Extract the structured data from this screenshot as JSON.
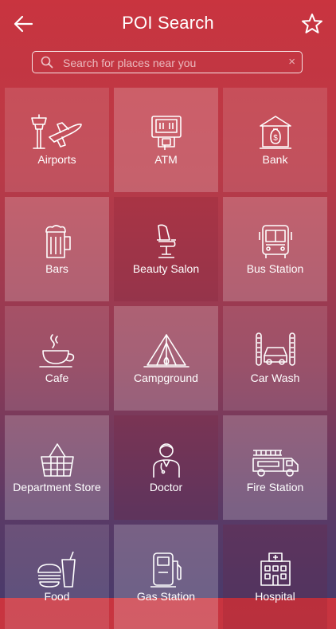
{
  "header": {
    "title": "POI Search"
  },
  "search": {
    "placeholder": "Search for places near you",
    "clear": "×"
  },
  "categories": [
    {
      "label": "Airports",
      "icon": "airport-icon"
    },
    {
      "label": "ATM",
      "icon": "atm-icon"
    },
    {
      "label": "Bank",
      "icon": "bank-icon"
    },
    {
      "label": "Bars",
      "icon": "beer-mug-icon"
    },
    {
      "label": "Beauty Salon",
      "icon": "salon-chair-icon"
    },
    {
      "label": "Bus Station",
      "icon": "bus-icon"
    },
    {
      "label": "Cafe",
      "icon": "coffee-cup-icon"
    },
    {
      "label": "Campground",
      "icon": "tent-icon"
    },
    {
      "label": "Car Wash",
      "icon": "car-wash-icon"
    },
    {
      "label": "Department Store",
      "icon": "basket-icon"
    },
    {
      "label": "Doctor",
      "icon": "doctor-icon"
    },
    {
      "label": "Fire Station",
      "icon": "fire-truck-icon"
    },
    {
      "label": "Food",
      "icon": "burger-drink-icon"
    },
    {
      "label": "Gas Station",
      "icon": "gas-pump-icon"
    },
    {
      "label": "Hospital",
      "icon": "hospital-building-icon"
    }
  ]
}
